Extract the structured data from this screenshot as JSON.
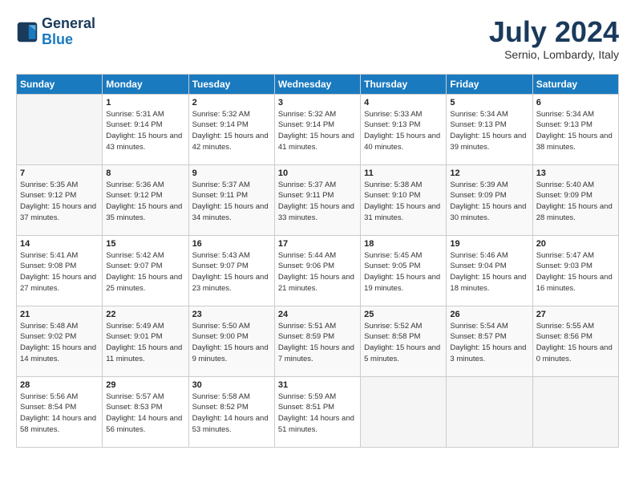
{
  "header": {
    "logo_general": "General",
    "logo_blue": "Blue",
    "month_title": "July 2024",
    "subtitle": "Sernio, Lombardy, Italy"
  },
  "days_of_week": [
    "Sunday",
    "Monday",
    "Tuesday",
    "Wednesday",
    "Thursday",
    "Friday",
    "Saturday"
  ],
  "weeks": [
    [
      {
        "day": "",
        "sunrise": "",
        "sunset": "",
        "daylight": ""
      },
      {
        "day": "1",
        "sunrise": "Sunrise: 5:31 AM",
        "sunset": "Sunset: 9:14 PM",
        "daylight": "Daylight: 15 hours and 43 minutes."
      },
      {
        "day": "2",
        "sunrise": "Sunrise: 5:32 AM",
        "sunset": "Sunset: 9:14 PM",
        "daylight": "Daylight: 15 hours and 42 minutes."
      },
      {
        "day": "3",
        "sunrise": "Sunrise: 5:32 AM",
        "sunset": "Sunset: 9:14 PM",
        "daylight": "Daylight: 15 hours and 41 minutes."
      },
      {
        "day": "4",
        "sunrise": "Sunrise: 5:33 AM",
        "sunset": "Sunset: 9:13 PM",
        "daylight": "Daylight: 15 hours and 40 minutes."
      },
      {
        "day": "5",
        "sunrise": "Sunrise: 5:34 AM",
        "sunset": "Sunset: 9:13 PM",
        "daylight": "Daylight: 15 hours and 39 minutes."
      },
      {
        "day": "6",
        "sunrise": "Sunrise: 5:34 AM",
        "sunset": "Sunset: 9:13 PM",
        "daylight": "Daylight: 15 hours and 38 minutes."
      }
    ],
    [
      {
        "day": "7",
        "sunrise": "Sunrise: 5:35 AM",
        "sunset": "Sunset: 9:12 PM",
        "daylight": "Daylight: 15 hours and 37 minutes."
      },
      {
        "day": "8",
        "sunrise": "Sunrise: 5:36 AM",
        "sunset": "Sunset: 9:12 PM",
        "daylight": "Daylight: 15 hours and 35 minutes."
      },
      {
        "day": "9",
        "sunrise": "Sunrise: 5:37 AM",
        "sunset": "Sunset: 9:11 PM",
        "daylight": "Daylight: 15 hours and 34 minutes."
      },
      {
        "day": "10",
        "sunrise": "Sunrise: 5:37 AM",
        "sunset": "Sunset: 9:11 PM",
        "daylight": "Daylight: 15 hours and 33 minutes."
      },
      {
        "day": "11",
        "sunrise": "Sunrise: 5:38 AM",
        "sunset": "Sunset: 9:10 PM",
        "daylight": "Daylight: 15 hours and 31 minutes."
      },
      {
        "day": "12",
        "sunrise": "Sunrise: 5:39 AM",
        "sunset": "Sunset: 9:09 PM",
        "daylight": "Daylight: 15 hours and 30 minutes."
      },
      {
        "day": "13",
        "sunrise": "Sunrise: 5:40 AM",
        "sunset": "Sunset: 9:09 PM",
        "daylight": "Daylight: 15 hours and 28 minutes."
      }
    ],
    [
      {
        "day": "14",
        "sunrise": "Sunrise: 5:41 AM",
        "sunset": "Sunset: 9:08 PM",
        "daylight": "Daylight: 15 hours and 27 minutes."
      },
      {
        "day": "15",
        "sunrise": "Sunrise: 5:42 AM",
        "sunset": "Sunset: 9:07 PM",
        "daylight": "Daylight: 15 hours and 25 minutes."
      },
      {
        "day": "16",
        "sunrise": "Sunrise: 5:43 AM",
        "sunset": "Sunset: 9:07 PM",
        "daylight": "Daylight: 15 hours and 23 minutes."
      },
      {
        "day": "17",
        "sunrise": "Sunrise: 5:44 AM",
        "sunset": "Sunset: 9:06 PM",
        "daylight": "Daylight: 15 hours and 21 minutes."
      },
      {
        "day": "18",
        "sunrise": "Sunrise: 5:45 AM",
        "sunset": "Sunset: 9:05 PM",
        "daylight": "Daylight: 15 hours and 19 minutes."
      },
      {
        "day": "19",
        "sunrise": "Sunrise: 5:46 AM",
        "sunset": "Sunset: 9:04 PM",
        "daylight": "Daylight: 15 hours and 18 minutes."
      },
      {
        "day": "20",
        "sunrise": "Sunrise: 5:47 AM",
        "sunset": "Sunset: 9:03 PM",
        "daylight": "Daylight: 15 hours and 16 minutes."
      }
    ],
    [
      {
        "day": "21",
        "sunrise": "Sunrise: 5:48 AM",
        "sunset": "Sunset: 9:02 PM",
        "daylight": "Daylight: 15 hours and 14 minutes."
      },
      {
        "day": "22",
        "sunrise": "Sunrise: 5:49 AM",
        "sunset": "Sunset: 9:01 PM",
        "daylight": "Daylight: 15 hours and 11 minutes."
      },
      {
        "day": "23",
        "sunrise": "Sunrise: 5:50 AM",
        "sunset": "Sunset: 9:00 PM",
        "daylight": "Daylight: 15 hours and 9 minutes."
      },
      {
        "day": "24",
        "sunrise": "Sunrise: 5:51 AM",
        "sunset": "Sunset: 8:59 PM",
        "daylight": "Daylight: 15 hours and 7 minutes."
      },
      {
        "day": "25",
        "sunrise": "Sunrise: 5:52 AM",
        "sunset": "Sunset: 8:58 PM",
        "daylight": "Daylight: 15 hours and 5 minutes."
      },
      {
        "day": "26",
        "sunrise": "Sunrise: 5:54 AM",
        "sunset": "Sunset: 8:57 PM",
        "daylight": "Daylight: 15 hours and 3 minutes."
      },
      {
        "day": "27",
        "sunrise": "Sunrise: 5:55 AM",
        "sunset": "Sunset: 8:56 PM",
        "daylight": "Daylight: 15 hours and 0 minutes."
      }
    ],
    [
      {
        "day": "28",
        "sunrise": "Sunrise: 5:56 AM",
        "sunset": "Sunset: 8:54 PM",
        "daylight": "Daylight: 14 hours and 58 minutes."
      },
      {
        "day": "29",
        "sunrise": "Sunrise: 5:57 AM",
        "sunset": "Sunset: 8:53 PM",
        "daylight": "Daylight: 14 hours and 56 minutes."
      },
      {
        "day": "30",
        "sunrise": "Sunrise: 5:58 AM",
        "sunset": "Sunset: 8:52 PM",
        "daylight": "Daylight: 14 hours and 53 minutes."
      },
      {
        "day": "31",
        "sunrise": "Sunrise: 5:59 AM",
        "sunset": "Sunset: 8:51 PM",
        "daylight": "Daylight: 14 hours and 51 minutes."
      },
      {
        "day": "",
        "sunrise": "",
        "sunset": "",
        "daylight": ""
      },
      {
        "day": "",
        "sunrise": "",
        "sunset": "",
        "daylight": ""
      },
      {
        "day": "",
        "sunrise": "",
        "sunset": "",
        "daylight": ""
      }
    ]
  ]
}
